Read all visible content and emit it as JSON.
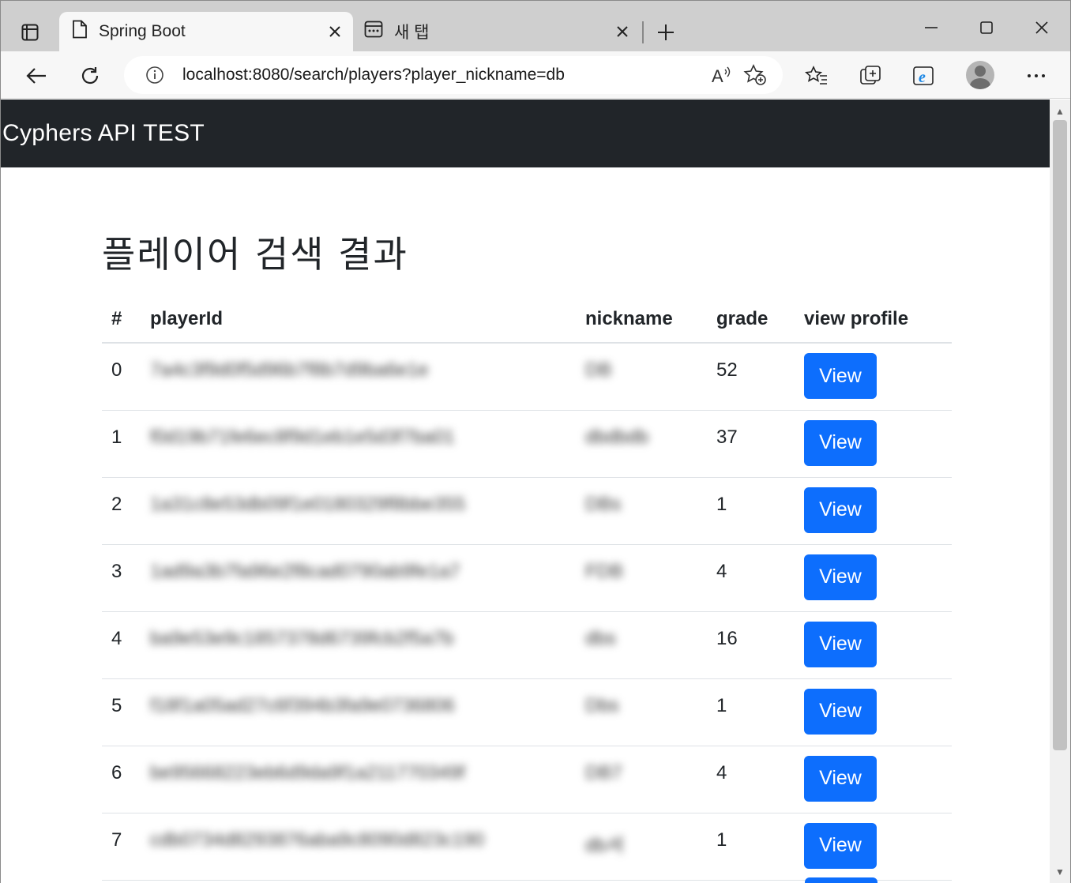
{
  "browser": {
    "tabs": [
      {
        "title": "Spring Boot",
        "active": true
      },
      {
        "title": "새 탭",
        "active": false
      }
    ],
    "address": {
      "url": "localhost:8080/search/players?player_nickname=db"
    }
  },
  "page": {
    "brand": "Cyphers API TEST",
    "title": "플레이어 검색 결과",
    "table": {
      "headers": {
        "index": "#",
        "player_id": "playerId",
        "nickname": "nickname",
        "grade": "grade",
        "view_profile": "view profile"
      },
      "rows": [
        {
          "index": "0",
          "player_id": "7a4c3f9d0f5d96b7f8b7d9ba6e1e",
          "nickname": "DB",
          "grade": "52",
          "button": "View"
        },
        {
          "index": "1",
          "player_id": "f0d19b71fe6ec8f9d1eb1e5d3f7ba01",
          "nickname": "dbdbdb",
          "grade": "37",
          "button": "View"
        },
        {
          "index": "2",
          "player_id": "1a31c8e53db09f1e0180329f8bbe355",
          "nickname": "DBs",
          "grade": "1",
          "button": "View"
        },
        {
          "index": "3",
          "player_id": "1ad9a3b7fa96e2f8cad0790ab9fe1a7",
          "nickname": "FDB",
          "grade": "4",
          "button": "View"
        },
        {
          "index": "4",
          "player_id": "ba9e53e9c1857378d6739fcb2f5a7b",
          "nickname": "dbs",
          "grade": "16",
          "button": "View"
        },
        {
          "index": "5",
          "player_id": "f18f1a05ad27c6f394b3fa9e0736806",
          "nickname": "Dbs",
          "grade": "1",
          "button": "View"
        },
        {
          "index": "6",
          "player_id": "be95668223eb6d9da9f1a211770349f",
          "nickname": "DB7",
          "grade": "4",
          "button": "View"
        },
        {
          "index": "7",
          "player_id": "cdb0734d8293876aba9c8090d823c190",
          "nickname": "db셔",
          "grade": "1",
          "button": "View"
        }
      ]
    }
  }
}
